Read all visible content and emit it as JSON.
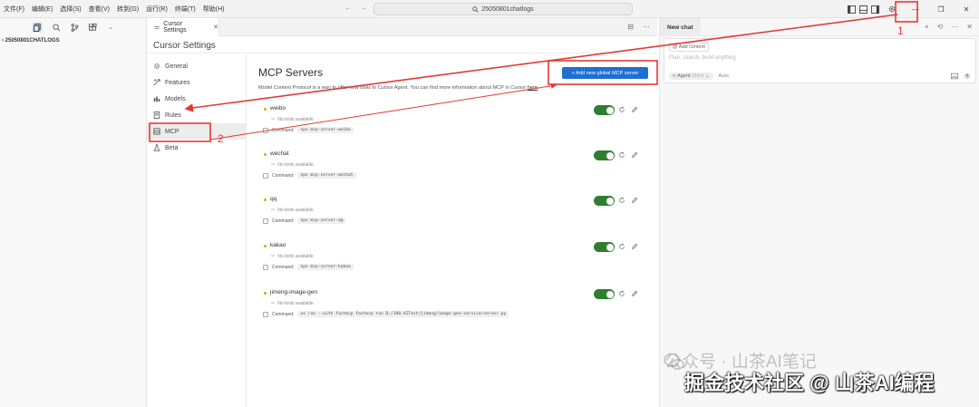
{
  "menus": [
    "文件(F)",
    "编辑(E)",
    "选择(S)",
    "查看(V)",
    "转到(G)",
    "运行(R)",
    "终端(T)",
    "帮助(H)"
  ],
  "search": {
    "text": "25050801chatlogs"
  },
  "explorer": {
    "folder_name": "25050801CHATLOGS"
  },
  "tab": {
    "label": "Cursor Settings"
  },
  "settings": {
    "title": "Cursor Settings",
    "nav": [
      {
        "label": "General",
        "icon": "gear-icon"
      },
      {
        "label": "Features",
        "icon": "features-icon"
      },
      {
        "label": "Models",
        "icon": "models-icon"
      },
      {
        "label": "Rules",
        "icon": "rules-icon"
      },
      {
        "label": "MCP",
        "icon": "mcp-icon",
        "selected": true
      },
      {
        "label": "Beta",
        "icon": "beta-icon"
      }
    ]
  },
  "mcp": {
    "title": "MCP Servers",
    "description": "Model Context Protocol is a way to offer new tools to Cursor Agent. You can find more information about MCP in Cursor",
    "description_link": "here",
    "add_button": "+ Add new global MCP server",
    "servers": [
      {
        "name": "weibo",
        "tools": "No tools available",
        "command_label": "Command:",
        "command": "npx mcp-server-weibo",
        "enabled": true
      },
      {
        "name": "wechat",
        "tools": "No tools available",
        "command_label": "Command:",
        "command": "npx mcp-server-wechat",
        "enabled": true
      },
      {
        "name": "qq",
        "tools": "No tools available",
        "command_label": "Command:",
        "command": "npx mcp-server-qq",
        "enabled": true
      },
      {
        "name": "kakao",
        "tools": "No tools available",
        "command_label": "Command:",
        "command": "npx mcp-server-kakao",
        "enabled": true
      },
      {
        "name": "jimeng-image-gen",
        "tools": "No tools available",
        "command_label": "Command:",
        "command": "uv run --with fastmcp fastmcp run D:/100.AITest/jimeng/image-gen-service/server.py",
        "enabled": true
      }
    ]
  },
  "chat": {
    "tab_label": "New chat",
    "add_context": "@ Add context",
    "placeholder": "Plan, search, build anything",
    "agent_label": "∞ Agent",
    "agent_shortcut": "Ctrl+I",
    "model": "Auto"
  },
  "annotations": {
    "label_1": "1",
    "label_2": "2"
  },
  "watermark": {
    "line1": "公众号 · 山茶AI笔记",
    "line2": "掘金技术社区 @ 山茶AI编程"
  },
  "colors": {
    "accent": "#1f6fd1",
    "toggle_on": "#2e7d32",
    "annotation": "#e53935",
    "status_dot": "#c8b400"
  }
}
